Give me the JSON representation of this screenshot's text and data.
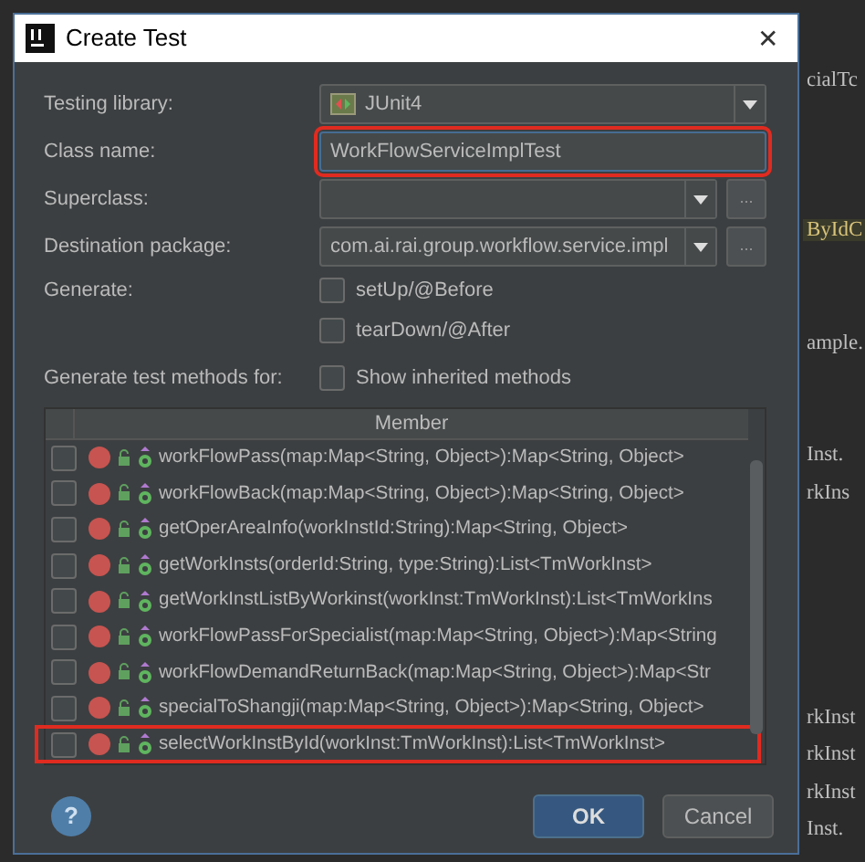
{
  "editor_fragments": [
    {
      "text": "cialTc",
      "highlighted": false
    },
    {
      "text": "ByIdC",
      "highlighted": true
    },
    {
      "text": "ample.",
      "highlighted": false
    },
    {
      "text": "Inst.",
      "highlighted": false
    },
    {
      "text": "rkIns",
      "highlighted": false
    },
    {
      "text": "rkInst",
      "highlighted": false
    },
    {
      "text": "rkInst",
      "highlighted": false
    },
    {
      "text": "rkInst",
      "highlighted": false
    },
    {
      "text": "Inst.",
      "highlighted": false
    }
  ],
  "window": {
    "title": "Create Test",
    "close": "✕"
  },
  "form": [
    {
      "kind": "combo",
      "label": "Testing library:",
      "value": "JUnit4"
    },
    {
      "kind": "text",
      "label": "Class name:",
      "value": "WorkFlowServiceImplTest",
      "focused": true,
      "highlighted": true
    },
    {
      "kind": "combo-browse",
      "label": "Superclass:",
      "browse": "..."
    },
    {
      "kind": "combo-browse",
      "label": "Destination package:",
      "value": "com.ai.rai.group.workflow.service.impl",
      "browse": "..."
    }
  ],
  "generate": {
    "label": "Generate:",
    "options": [
      {
        "label": "setUp/@Before",
        "checked": false
      },
      {
        "label": "tearDown/@After",
        "checked": false
      }
    ]
  },
  "methods": {
    "label": "Generate test methods for:",
    "inherited": {
      "label": "Show inherited methods",
      "checked": false
    },
    "column": "Member",
    "rows": [
      {
        "text": "workFlowPass(map:Map<String, Object>):Map<String, Object>",
        "checked": false,
        "highlighted": false
      },
      {
        "text": "workFlowBack(map:Map<String, Object>):Map<String, Object>",
        "checked": false,
        "highlighted": false
      },
      {
        "text": "getOperAreaInfo(workInstId:String):Map<String, Object>",
        "checked": false,
        "highlighted": false
      },
      {
        "text": "getWorkInsts(orderId:String, type:String):List<TmWorkInst>",
        "checked": false,
        "highlighted": false
      },
      {
        "text": "getWorkInstListByWorkinst(workInst:TmWorkInst):List<TmWorkIns",
        "checked": false,
        "highlighted": false
      },
      {
        "text": "workFlowPassForSpecialist(map:Map<String, Object>):Map<String",
        "checked": false,
        "highlighted": false
      },
      {
        "text": "workFlowDemandReturnBack(map:Map<String, Object>):Map<Str",
        "checked": false,
        "highlighted": false
      },
      {
        "text": "specialToShangji(map:Map<String, Object>):Map<String, Object>",
        "checked": false,
        "highlighted": false
      },
      {
        "text": "selectWorkInstById(workInst:TmWorkInst):List<TmWorkInst>",
        "checked": false,
        "highlighted": true
      }
    ]
  },
  "buttons": [
    {
      "label": "OK",
      "default": true
    },
    {
      "label": "Cancel",
      "default": false
    }
  ],
  "help": "?"
}
